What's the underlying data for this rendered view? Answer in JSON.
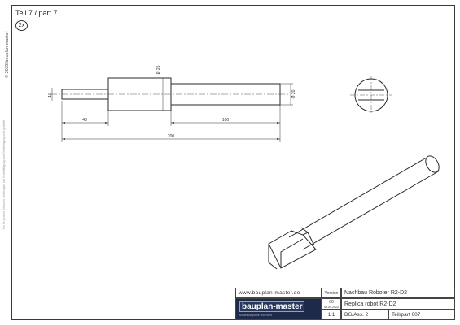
{
  "sheet": {
    "part_title": "Teil 7 / part 7",
    "quantity": "2x",
    "copyright": "© 2023 bauplan-master",
    "disclaimer": "Nur für privaten Gebrauch - Weitergabe und Vervielfältigung ohne Genehmigung nicht gestattet"
  },
  "drawing": {
    "dim_total": "200",
    "dim_left_segment": "43",
    "dim_right_segment": "100",
    "dim_left_height": "10",
    "dim_mid_diameter": "Ø 25",
    "dim_right_diameter": "Ø 20"
  },
  "title_block": {
    "website": "www.bauplan-master.de",
    "logo_brand": "bauplan-master",
    "logo_tagline": "Modellbaupläne und mehr",
    "version_label": "Version",
    "version_value": "00",
    "version_date": "09.04.2023",
    "scale": "1:1",
    "name_de": "Nachbau Roboter R2-D2",
    "name_en": "Replica robot R2-D2",
    "assembly": "BG/Ass. 2",
    "part_number": "Teil/part 007"
  },
  "colors": {
    "line": "#2a2a2a",
    "frame": "#3a3a3a",
    "logo_bg": "#1e2a4a"
  }
}
